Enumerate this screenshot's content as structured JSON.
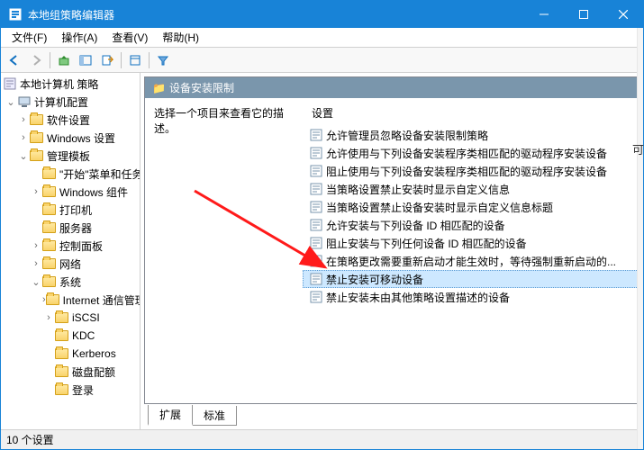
{
  "window": {
    "title": "本地组策略编辑器"
  },
  "menu": {
    "file": "文件(F)",
    "action": "操作(A)",
    "view": "查看(V)",
    "help": "帮助(H)"
  },
  "tree": {
    "root": "本地计算机 策略",
    "computer": "计算机配置",
    "software": "软件设置",
    "windows_settings": "Windows 设置",
    "admin_templates": "管理模板",
    "start_menu": "\"开始\"菜单和任务栏",
    "windows_components": "Windows 组件",
    "printers": "打印机",
    "servers": "服务器",
    "control_panel": "控制面板",
    "network": "网络",
    "system": "系统",
    "internet": "Internet 通信管理",
    "iscsi": "iSCSI",
    "kdc": "KDC",
    "kerberos": "Kerberos",
    "disk": "磁盘配额",
    "login": "登录"
  },
  "category": {
    "title": "设备安装限制"
  },
  "description": {
    "prompt": "选择一个项目来查看它的描述。"
  },
  "column": {
    "setting": "设置"
  },
  "settings": [
    "允许管理员忽略设备安装限制策略",
    "允许使用与下列设备安装程序类相匹配的驱动程序安装设备",
    "阻止使用与下列设备安装程序类相匹配的驱动程序安装设备",
    "当策略设置禁止安装时显示自定义信息",
    "当策略设置禁止设备安装时显示自定义信息标题",
    "允许安装与下列设备 ID 相匹配的设备",
    "阻止安装与下列任何设备 ID 相匹配的设备",
    "在策略更改需要重新启动才能生效时，等待强制重新启动的...",
    "禁止安装可移动设备",
    "禁止安装未由其他策略设置描述的设备"
  ],
  "tabs": {
    "extended": "扩展",
    "standard": "标准"
  },
  "status": {
    "count": "10 个设置"
  },
  "side_char": "可"
}
